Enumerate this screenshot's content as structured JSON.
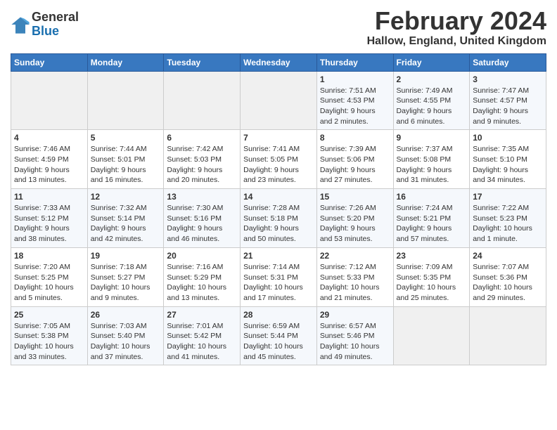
{
  "header": {
    "logo_general": "General",
    "logo_blue": "Blue",
    "title": "February 2024",
    "subtitle": "Hallow, England, United Kingdom"
  },
  "calendar": {
    "days_of_week": [
      "Sunday",
      "Monday",
      "Tuesday",
      "Wednesday",
      "Thursday",
      "Friday",
      "Saturday"
    ],
    "rows": [
      [
        {
          "day": "",
          "detail": ""
        },
        {
          "day": "",
          "detail": ""
        },
        {
          "day": "",
          "detail": ""
        },
        {
          "day": "",
          "detail": ""
        },
        {
          "day": "1",
          "detail": "Sunrise: 7:51 AM\nSunset: 4:53 PM\nDaylight: 9 hours\nand 2 minutes."
        },
        {
          "day": "2",
          "detail": "Sunrise: 7:49 AM\nSunset: 4:55 PM\nDaylight: 9 hours\nand 6 minutes."
        },
        {
          "day": "3",
          "detail": "Sunrise: 7:47 AM\nSunset: 4:57 PM\nDaylight: 9 hours\nand 9 minutes."
        }
      ],
      [
        {
          "day": "4",
          "detail": "Sunrise: 7:46 AM\nSunset: 4:59 PM\nDaylight: 9 hours\nand 13 minutes."
        },
        {
          "day": "5",
          "detail": "Sunrise: 7:44 AM\nSunset: 5:01 PM\nDaylight: 9 hours\nand 16 minutes."
        },
        {
          "day": "6",
          "detail": "Sunrise: 7:42 AM\nSunset: 5:03 PM\nDaylight: 9 hours\nand 20 minutes."
        },
        {
          "day": "7",
          "detail": "Sunrise: 7:41 AM\nSunset: 5:05 PM\nDaylight: 9 hours\nand 23 minutes."
        },
        {
          "day": "8",
          "detail": "Sunrise: 7:39 AM\nSunset: 5:06 PM\nDaylight: 9 hours\nand 27 minutes."
        },
        {
          "day": "9",
          "detail": "Sunrise: 7:37 AM\nSunset: 5:08 PM\nDaylight: 9 hours\nand 31 minutes."
        },
        {
          "day": "10",
          "detail": "Sunrise: 7:35 AM\nSunset: 5:10 PM\nDaylight: 9 hours\nand 34 minutes."
        }
      ],
      [
        {
          "day": "11",
          "detail": "Sunrise: 7:33 AM\nSunset: 5:12 PM\nDaylight: 9 hours\nand 38 minutes."
        },
        {
          "day": "12",
          "detail": "Sunrise: 7:32 AM\nSunset: 5:14 PM\nDaylight: 9 hours\nand 42 minutes."
        },
        {
          "day": "13",
          "detail": "Sunrise: 7:30 AM\nSunset: 5:16 PM\nDaylight: 9 hours\nand 46 minutes."
        },
        {
          "day": "14",
          "detail": "Sunrise: 7:28 AM\nSunset: 5:18 PM\nDaylight: 9 hours\nand 50 minutes."
        },
        {
          "day": "15",
          "detail": "Sunrise: 7:26 AM\nSunset: 5:20 PM\nDaylight: 9 hours\nand 53 minutes."
        },
        {
          "day": "16",
          "detail": "Sunrise: 7:24 AM\nSunset: 5:21 PM\nDaylight: 9 hours\nand 57 minutes."
        },
        {
          "day": "17",
          "detail": "Sunrise: 7:22 AM\nSunset: 5:23 PM\nDaylight: 10 hours\nand 1 minute."
        }
      ],
      [
        {
          "day": "18",
          "detail": "Sunrise: 7:20 AM\nSunset: 5:25 PM\nDaylight: 10 hours\nand 5 minutes."
        },
        {
          "day": "19",
          "detail": "Sunrise: 7:18 AM\nSunset: 5:27 PM\nDaylight: 10 hours\nand 9 minutes."
        },
        {
          "day": "20",
          "detail": "Sunrise: 7:16 AM\nSunset: 5:29 PM\nDaylight: 10 hours\nand 13 minutes."
        },
        {
          "day": "21",
          "detail": "Sunrise: 7:14 AM\nSunset: 5:31 PM\nDaylight: 10 hours\nand 17 minutes."
        },
        {
          "day": "22",
          "detail": "Sunrise: 7:12 AM\nSunset: 5:33 PM\nDaylight: 10 hours\nand 21 minutes."
        },
        {
          "day": "23",
          "detail": "Sunrise: 7:09 AM\nSunset: 5:35 PM\nDaylight: 10 hours\nand 25 minutes."
        },
        {
          "day": "24",
          "detail": "Sunrise: 7:07 AM\nSunset: 5:36 PM\nDaylight: 10 hours\nand 29 minutes."
        }
      ],
      [
        {
          "day": "25",
          "detail": "Sunrise: 7:05 AM\nSunset: 5:38 PM\nDaylight: 10 hours\nand 33 minutes."
        },
        {
          "day": "26",
          "detail": "Sunrise: 7:03 AM\nSunset: 5:40 PM\nDaylight: 10 hours\nand 37 minutes."
        },
        {
          "day": "27",
          "detail": "Sunrise: 7:01 AM\nSunset: 5:42 PM\nDaylight: 10 hours\nand 41 minutes."
        },
        {
          "day": "28",
          "detail": "Sunrise: 6:59 AM\nSunset: 5:44 PM\nDaylight: 10 hours\nand 45 minutes."
        },
        {
          "day": "29",
          "detail": "Sunrise: 6:57 AM\nSunset: 5:46 PM\nDaylight: 10 hours\nand 49 minutes."
        },
        {
          "day": "",
          "detail": ""
        },
        {
          "day": "",
          "detail": ""
        }
      ]
    ]
  }
}
